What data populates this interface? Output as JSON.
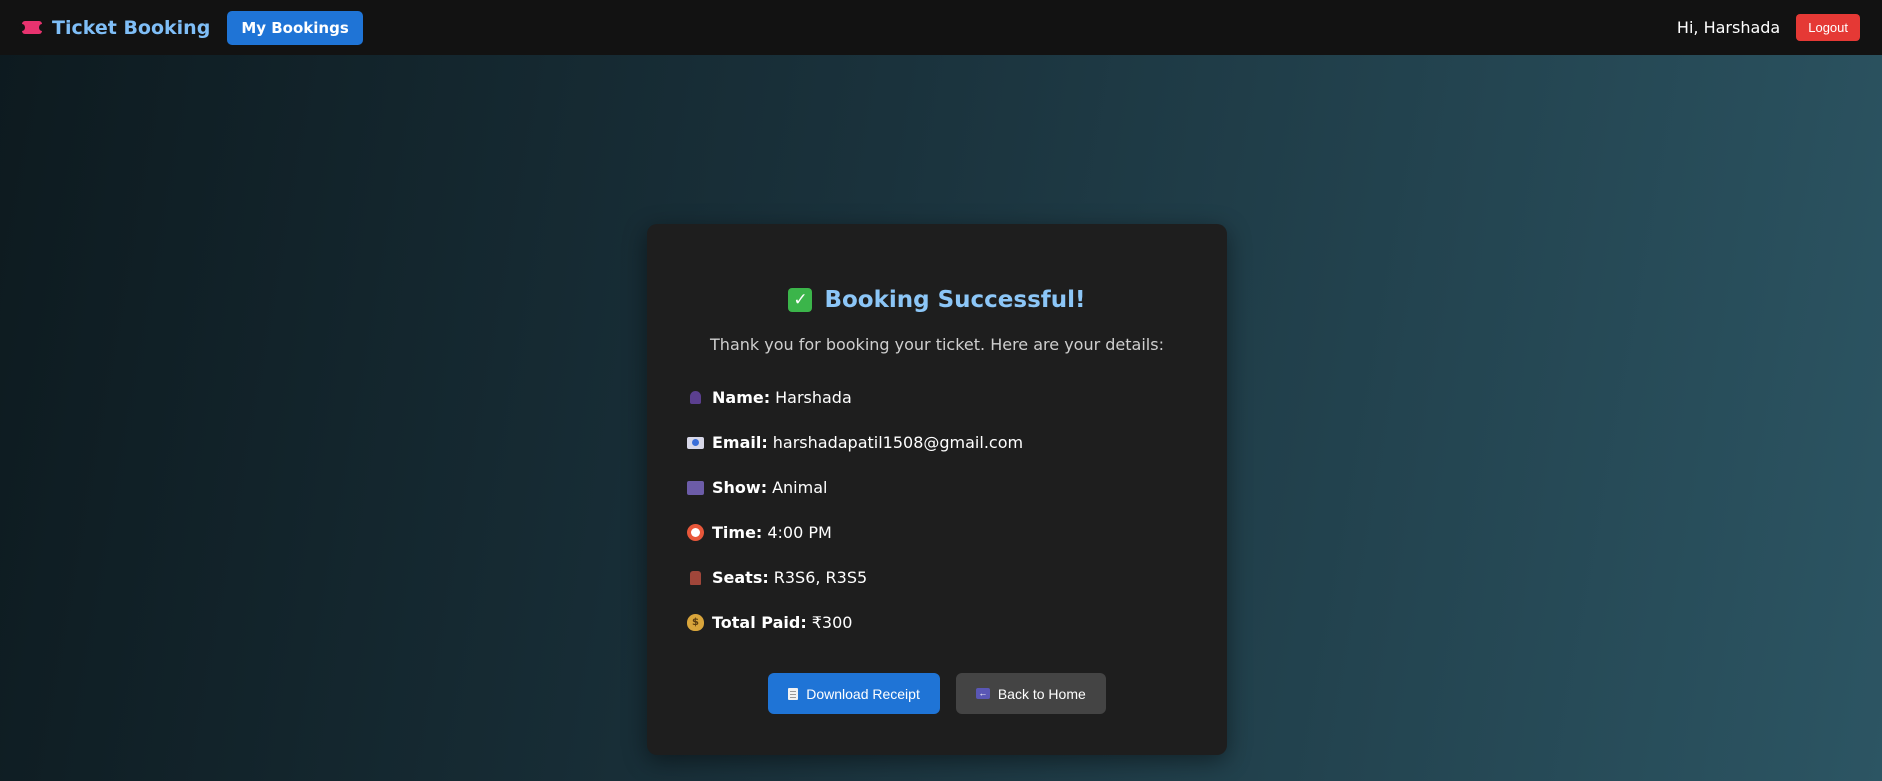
{
  "navbar": {
    "brand": "Ticket Booking",
    "brand_icon": "ticket-icon",
    "my_bookings_label": "My Bookings",
    "greeting": "Hi, Harshada",
    "logout_label": "Logout"
  },
  "card": {
    "title": "Booking Successful!",
    "title_icon": "check-mark-icon",
    "subtitle": "Thank you for booking your ticket. Here are your details:",
    "details": [
      {
        "icon": "user-icon",
        "label": "Name:",
        "value": "Harshada"
      },
      {
        "icon": "email-icon",
        "label": "Email:",
        "value": "harshadapatil1508@gmail.com"
      },
      {
        "icon": "clapperboard-icon",
        "label": "Show:",
        "value": "Animal"
      },
      {
        "icon": "alarm-clock-icon",
        "label": "Time:",
        "value": "4:00 PM"
      },
      {
        "icon": "seat-icon",
        "label": "Seats:",
        "value": "R3S6, R3S5"
      },
      {
        "icon": "money-bag-icon",
        "label": "Total Paid:",
        "value": "₹300"
      }
    ],
    "download_label": "Download Receipt",
    "back_label": "Back to Home"
  },
  "colors": {
    "accent": "#1f74d6",
    "title": "#8cc6f7",
    "logout": "#e53935",
    "card_bg": "#1e1e1e",
    "navbar_bg": "#121212"
  }
}
